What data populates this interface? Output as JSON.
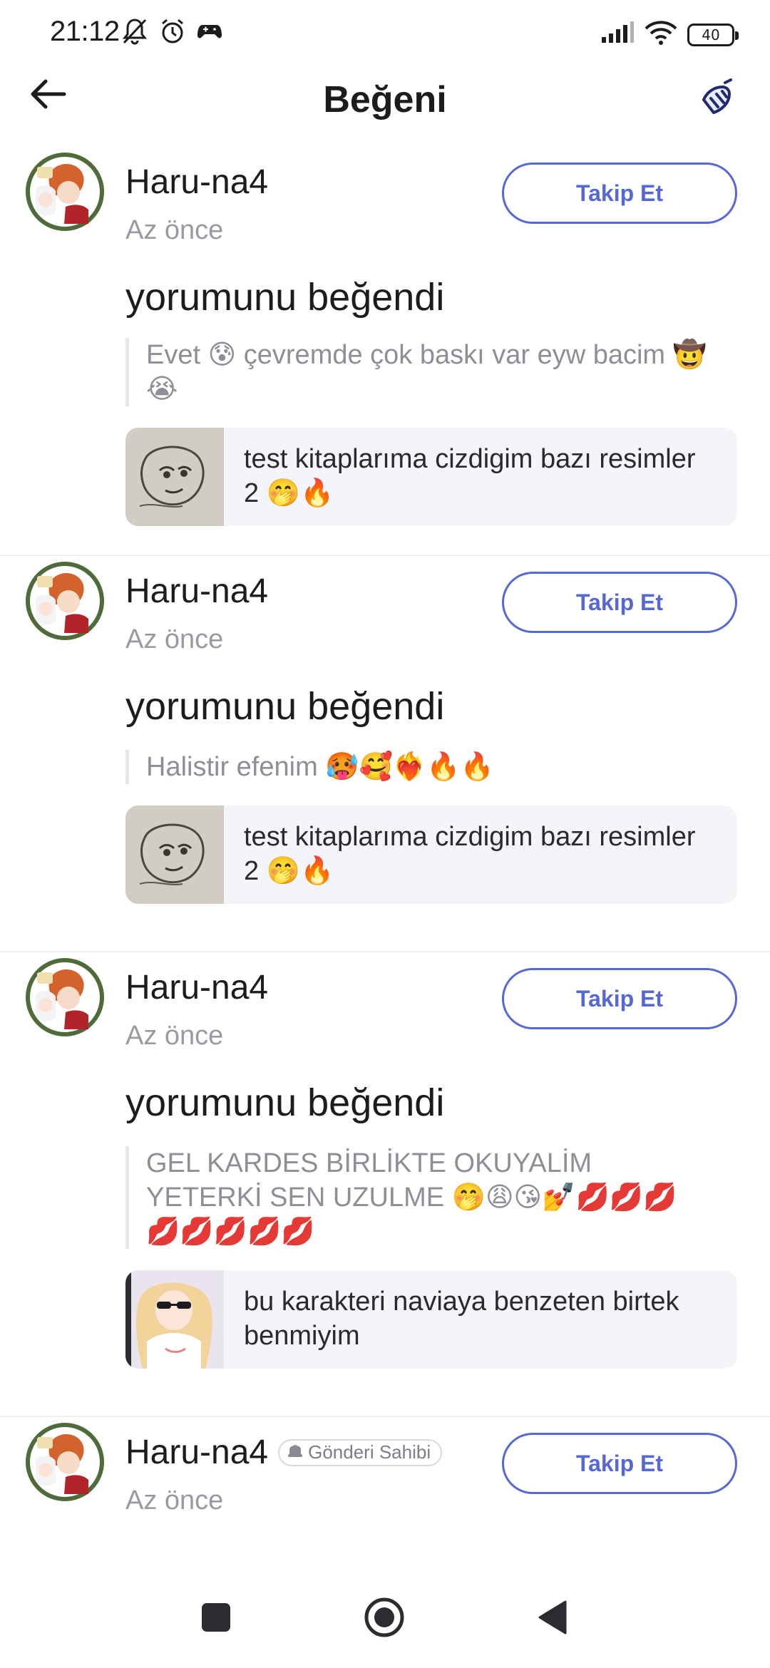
{
  "status_bar": {
    "time": "21:12",
    "battery": "40",
    "icons": [
      "bell-off-icon",
      "alarm-icon",
      "gamepad-icon",
      "signal-icon",
      "wifi-icon",
      "battery-icon"
    ]
  },
  "header": {
    "title": "Beğeni",
    "back_icon": "arrow-left-icon",
    "action_icon": "broom-icon"
  },
  "notifications": [
    {
      "user": "Haru-na4",
      "time": "Az önce",
      "follow_label": "Takip Et",
      "action": "yorumunu beğendi",
      "comment": "Evet 😰 çevremde çok baskı var eyw bacim 🤠😭",
      "post_title": "test kitaplarıma cizdigim bazı resimler 2 🤭🔥"
    },
    {
      "user": "Haru-na4",
      "time": "Az önce",
      "follow_label": "Takip Et",
      "action": "yorumunu beğendi",
      "comment": "Halistir efenim 🥵🥰❤️‍🔥🔥🔥",
      "post_title": "test kitaplarıma cizdigim bazı resimler 2 🤭🔥"
    },
    {
      "user": "Haru-na4",
      "time": "Az önce",
      "follow_label": "Takip Et",
      "action": "yorumunu beğendi",
      "comment": "GEL KARDES BİRLİKTE OKUYALİM YETERKİ SEN UZULME 🤭😩😘💅💋💋💋💋💋💋💋💋",
      "post_title": "bu karakteri naviaya benzeten birtek benmiyim"
    },
    {
      "user": "Haru-na4",
      "badge": "Gönderi Sahibi",
      "time": "Az önce",
      "follow_label": "Takip Et"
    }
  ],
  "nav_bar": {
    "icons": [
      "recents-square-icon",
      "home-circle-icon",
      "back-triangle-icon"
    ]
  },
  "colors": {
    "accent": "#5568d6",
    "muted_text": "#9a9aa2",
    "card_bg": "#f4f5f9"
  }
}
